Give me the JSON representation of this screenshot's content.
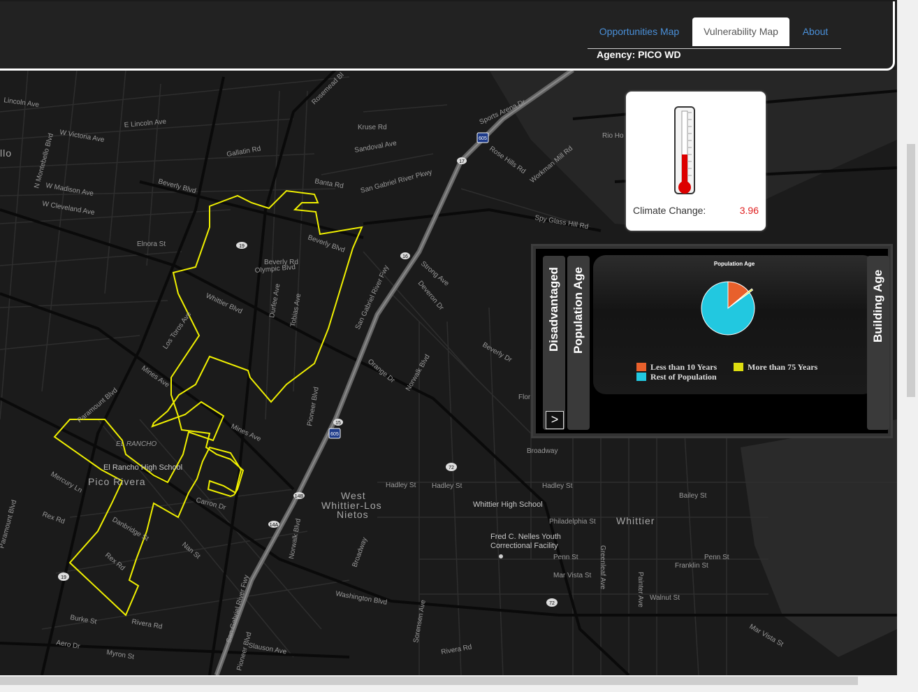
{
  "tabs": [
    {
      "label": "Opportunities Map"
    },
    {
      "label": "Vulnerability Map"
    },
    {
      "label": "About"
    }
  ],
  "agency": "Agency: PICO WD",
  "climate": {
    "label": "Climate Change:",
    "value": "3.96"
  },
  "panel": {
    "tab_disadvantaged": "Disadvantaged",
    "tab_population_age": "Population Age",
    "tab_building_age": "Building Age",
    "arrow": ">",
    "chart_title": "Population Age",
    "legend": [
      {
        "label": "Less than 10 Years",
        "color": "#e8602c"
      },
      {
        "label": "More than 75 Years",
        "color": "#dddd10"
      },
      {
        "label": "Rest of Population",
        "color": "#22c8e0"
      }
    ]
  },
  "chart_data": {
    "type": "pie",
    "title": "Population Age",
    "categories": [
      "Less than 10 Years",
      "More than 75 Years",
      "Rest of Population"
    ],
    "values": [
      14,
      1,
      85
    ],
    "colors": [
      "#e8602c",
      "#dddd10",
      "#22c8e0"
    ]
  },
  "map": {
    "places": {
      "pico_rivera": "Pico Rivera",
      "el_rancho": "EL RANCHO",
      "west_whittier": "West",
      "west_whittier2": "Whittier-Los",
      "west_whittier3": "Nietos",
      "whittier": "Whittier",
      "montebello": "llo",
      "rio_hondo": "Rio Ho"
    },
    "pois": {
      "el_rancho_hs": "El Rancho High School",
      "whittier_hs": "Whittier High School",
      "nelles1": "Fred C. Nelles Youth",
      "nelles2": "Correctional Facility"
    },
    "streets": {
      "lincoln_ave": "Lincoln Ave",
      "e_lincoln_ave": "E Lincoln Ave",
      "w_victoria_ave": "W Victoria Ave",
      "n_montebello": "N Montebello Blvd",
      "w_madison": "W Madison Ave",
      "w_cleveland": "W Cleveland Ave",
      "beverly_blvd": "Beverly Blvd",
      "beverly_blvd2": "Beverly Blvd",
      "whittier_blvd": "Whittier Blvd",
      "mines_ave": "Mines Ave",
      "mines_ave2": "Mines Ave",
      "paramount": "Paramount Blvd",
      "paramount2": "Paramount Blvd",
      "rosemead": "Rosemead Bl",
      "sgr_fwy": "San Gabriel River Fwy",
      "sgr_fwy2": "San Gabriel River Fwy",
      "sgr_pkwy": "San Gabriel River Pkwy",
      "kruse": "Kruse Rd",
      "sandoval": "Sandoval Ave",
      "sports_arena": "Sports Arena Dr",
      "rose_hills": "Rose Hills Rd",
      "workman_mill": "Workman Mill Rd",
      "spy_glass": "Spy Glass Hill Rd",
      "gallatin": "Gallatin Rd",
      "banta": "Banta Rd",
      "olympic": "Olympic Blvd",
      "beverly_rd": "Beverly Rd",
      "durfee": "Durfee Ave",
      "tobias": "Tobias Ave",
      "los_toros": "Los Toros Ave",
      "strong": "Strong Ave",
      "deveron": "Deveron Dr",
      "orange": "Orange Dr",
      "norwalk": "Norwalk Blvd",
      "norwalk2": "Norwalk Blvd",
      "pioneer": "Pioneer Blvd",
      "pioneer2": "Pioneer Blvd",
      "hadley": "Hadley St",
      "hadley2": "Hadley St",
      "hadley3": "Hadley St",
      "philadelphia": "Philadelphia St",
      "washington": "Washington Blvd",
      "slauson": "Slauson Ave",
      "rivera": "Rivera Rd",
      "rivera2": "Rivera Rd",
      "burke": "Burke St",
      "mercury": "Mercury Ln",
      "rex": "Rex Rd",
      "rex2": "Rex Rd",
      "danbridge": "Danbridge St",
      "nan": "Nan St",
      "carron": "Carron Dr",
      "broadway": "Broadway",
      "broadway2": "Broadway",
      "penn": "Penn St",
      "penn2": "Penn St",
      "mar_vista": "Mar Vista St",
      "mar_vista2": "Mar Vista St",
      "franklin": "Franklin St",
      "walnut": "Walnut St",
      "bailey": "Bailey St",
      "painter": "Painter Ave",
      "greenleaf": "Greenleaf Ave",
      "sorensen": "Sorensen Ave",
      "beverly_dr": "Beverly Dr",
      "aero": "Aero Dr",
      "myron": "Myron St",
      "elnora": "Elnora St",
      "flor": "Flor"
    },
    "shields": [
      "605",
      "17",
      "16",
      "15",
      "72",
      "14B",
      "14A",
      "19",
      "72",
      "605"
    ]
  }
}
